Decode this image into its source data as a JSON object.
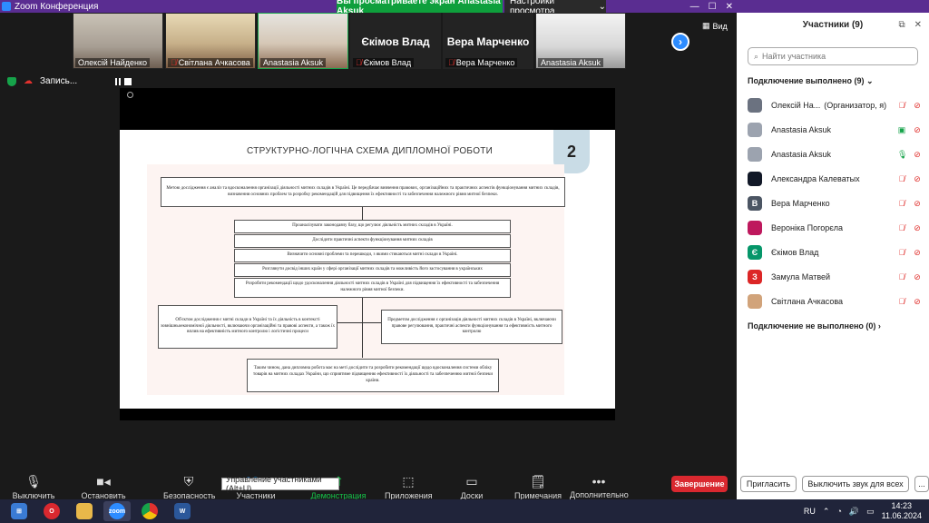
{
  "titlebar": {
    "app_title": "Zoom Конференция",
    "share_banner": "Вы просматриваете экран Anastasia Aksuk",
    "view_settings": "Настройки просмотра"
  },
  "thumbs": [
    {
      "name": "Олексій Найденко",
      "muted": false
    },
    {
      "name": "Світлана Ачкасова",
      "muted": true
    },
    {
      "name": "Anastasia Aksuk",
      "muted": false,
      "active": true
    },
    {
      "name": "Єкімов Влад",
      "muted": true,
      "big": "Єкімов Влад"
    },
    {
      "name": "Вера Марченко",
      "muted": true,
      "big": "Вера Марченко"
    },
    {
      "name": "Anastasia Aksuk",
      "muted": false
    }
  ],
  "view_label": "Вид",
  "recording": {
    "label": "Запись..."
  },
  "slide": {
    "number": "2",
    "title": "СТРУКТУРНО-ЛОГІЧНА СХЕМА ДИПЛОМНОЇ РОБОТИ",
    "goal": "Метою дослідження є аналіз та вдосконалення організації діяльності митних складів в Україні. Це передбачає вивчення правових, організаційних та практичних аспектів функціонування митних складів, визначення основних проблем та розробку рекомендацій для підвищення їх ефективності та забезпечення належного рівня митної безпеки.",
    "tasks": [
      "Проаналізувати законодавчу базу, що регулює діяльність митних складів в Україні.",
      "Дослідити практичні аспекти функціонування митних складів",
      "Визначити основні проблеми та перешкоди, з якими стикаються митні склади в Україні.",
      "Розглянути досвід інших країн у сфері організації митних складів та можливість його застосування в українських",
      "Розробити рекомендації щодо удосконалення діяльності митних складів в Україні для підвищення їх ефективності та забезпечення належного рівня митної безпеки."
    ],
    "object": "Об'єктом дослідження є митні склади в Україні та їх діяльність в контексті зовнішньоекономічної діяльності, включаючи організаційні та правові аспекти, а також їх вплив на ефективність митного контролю і логістичні процеси",
    "subject": "Предметом дослідження є організація діяльності митних складів в Україні, включаючи правове регулювання, практичні аспекти функціонування та ефективність митного контролю",
    "conclusion": "Таким чином, дана дипломна робота має на меті дослідити та розробити рекомендації щодо вдосконалення системи обліку товарів на митних складах України, що сприятиме підвищенню ефективності їх діяльності та забезпеченню митної безпеки країни."
  },
  "toolbar": {
    "mute": "Выключить звук",
    "stop_video": "Остановить видео",
    "security": "Безопасность",
    "participants": "Участники",
    "participants_count": "9",
    "share": "Демонстрация экрана",
    "apps": "Приложения",
    "whiteboards": "Доски сообщений",
    "notes": "Примечания",
    "more": "Дополнительно",
    "tooltip": "Управление участниками (Alt+U)",
    "end": "Завершение"
  },
  "panel": {
    "title": "Участники (9)",
    "search_placeholder": "Найти участника",
    "connected_header": "Подключение выполнено (9)",
    "not_connected_header": "Подключение не выполнено (0)",
    "participants": [
      {
        "name": "Олексій На...",
        "role": "(Организатор, я)",
        "avatar_color": "#6b7280",
        "initial": "",
        "mic": "off",
        "video": "off"
      },
      {
        "name": "Anastasia Aksuk",
        "role": "",
        "avatar_color": "#9ca3af",
        "initial": "",
        "mic": "share",
        "video": "off"
      },
      {
        "name": "Anastasia Aksuk",
        "role": "",
        "avatar_color": "#9ca3af",
        "initial": "",
        "mic": "on",
        "video": "off"
      },
      {
        "name": "Александра Калеватых",
        "role": "",
        "avatar_color": "#111827",
        "initial": "",
        "mic": "off",
        "video": "off"
      },
      {
        "name": "Вера Марченко",
        "role": "",
        "avatar_color": "#4b5563",
        "initial": "В",
        "mic": "off",
        "video": "off"
      },
      {
        "name": "Вероніка Погорєла",
        "role": "",
        "avatar_color": "#be185d",
        "initial": "",
        "mic": "off",
        "video": "off"
      },
      {
        "name": "Єкімов Влад",
        "role": "",
        "avatar_color": "#059669",
        "initial": "Є",
        "mic": "off",
        "video": "off"
      },
      {
        "name": "Замула Матвей",
        "role": "",
        "avatar_color": "#dc2626",
        "initial": "З",
        "mic": "off",
        "video": "off"
      },
      {
        "name": "Світлана Ачкасова",
        "role": "",
        "avatar_color": "#d1a37a",
        "initial": "",
        "mic": "off",
        "video": "off"
      }
    ],
    "invite": "Пригласить",
    "mute_all": "Выключить звук для всех",
    "more": "..."
  },
  "taskbar": {
    "lang": "RU",
    "time": "14:23",
    "date": "11.06.2024",
    "apps": [
      "windows",
      "opera",
      "files",
      "zoom",
      "chrome",
      "word"
    ]
  }
}
